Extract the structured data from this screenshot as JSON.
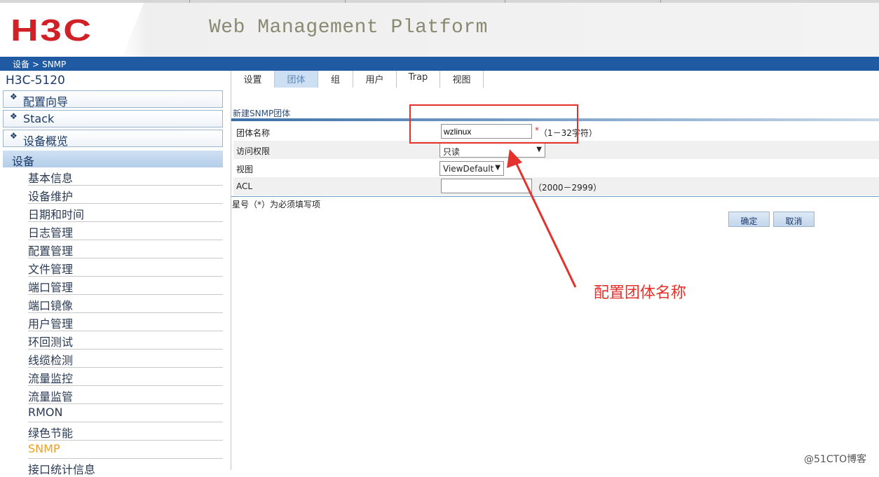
{
  "header": {
    "logo": "H3C",
    "title": "Web Management Platform"
  },
  "breadcrumb": {
    "parent": "设备",
    "separator": ">",
    "current": "SNMP"
  },
  "sidebar": {
    "device_name": "H3C-5120",
    "groups": [
      {
        "label": "配置向导"
      },
      {
        "label": "Stack"
      },
      {
        "label": "设备概览"
      }
    ],
    "active_group": "设备",
    "items": [
      {
        "label": "基本信息"
      },
      {
        "label": "设备维护"
      },
      {
        "label": "日期和时间"
      },
      {
        "label": "日志管理"
      },
      {
        "label": "配置管理"
      },
      {
        "label": "文件管理"
      },
      {
        "label": "端口管理"
      },
      {
        "label": "端口镜像"
      },
      {
        "label": "用户管理"
      },
      {
        "label": "环回测试"
      },
      {
        "label": "线缆检测"
      },
      {
        "label": "流量监控"
      },
      {
        "label": "流量监管"
      },
      {
        "label": "RMON"
      },
      {
        "label": "绿色节能"
      },
      {
        "label": "SNMP"
      },
      {
        "label": "接口统计信息"
      }
    ]
  },
  "tabs": [
    {
      "label": "设置"
    },
    {
      "label": "团体"
    },
    {
      "label": "组"
    },
    {
      "label": "用户"
    },
    {
      "label": "Trap"
    },
    {
      "label": "视图"
    }
  ],
  "form": {
    "title": "新建SNMP团体",
    "community_name": {
      "label": "团体名称",
      "value": "wzlinux",
      "required": "*",
      "hint": "（1－32字符）"
    },
    "access": {
      "label": "访问权限",
      "value": "只读"
    },
    "view": {
      "label": "视图",
      "value": "ViewDefault"
    },
    "acl": {
      "label": "ACL",
      "value": "",
      "hint": "（2000－2999）"
    },
    "required_note": "星号（*）为必须填写项",
    "ok_label": "确定",
    "cancel_label": "取消"
  },
  "annotation": {
    "text": "配置团体名称",
    "color": "#e4312b"
  },
  "watermark": "@51CTO博客",
  "colors": {
    "brand_red": "#d22027",
    "bar_blue": "#1f5aa3",
    "active_item": "#f0a020"
  }
}
